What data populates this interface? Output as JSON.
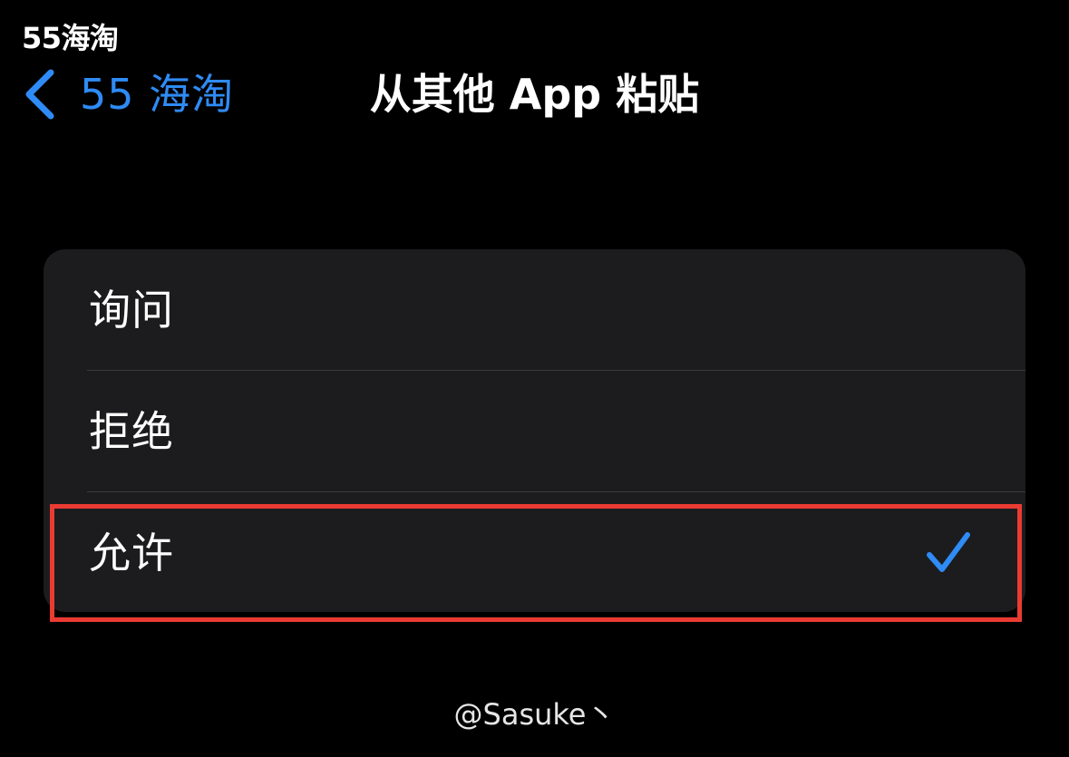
{
  "status_bar": {
    "app_name": "55海淘"
  },
  "nav": {
    "back_label": "55 海淘",
    "back_icon": "chevron-left-icon",
    "title": "从其他 App 粘贴"
  },
  "options": [
    {
      "label": "询问",
      "selected": false
    },
    {
      "label": "拒绝",
      "selected": false
    },
    {
      "label": "允许",
      "selected": true
    }
  ],
  "watermark": "@Sasuke丶",
  "colors": {
    "accent": "#2f8bf5",
    "background": "#000000",
    "card": "#1c1c1e",
    "divider": "#3a3a3c",
    "highlight": "#ea3b33"
  }
}
